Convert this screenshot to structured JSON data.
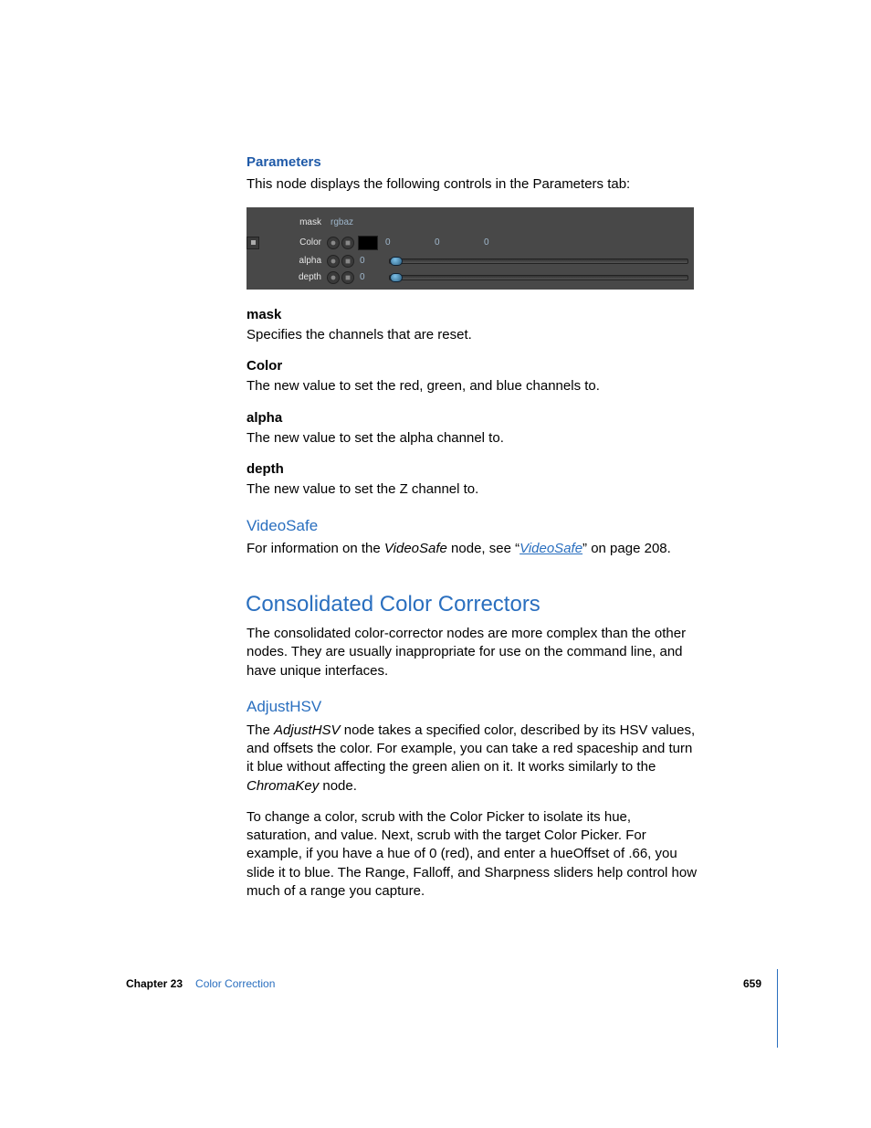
{
  "sections": {
    "parameters": {
      "heading": "Parameters",
      "intro": "This node displays the following controls in the Parameters tab:"
    },
    "panel": {
      "mask_label": "mask",
      "mask_value": "rgbaz",
      "color_label": "Color",
      "color_v1": "0",
      "color_v2": "0",
      "color_v3": "0",
      "alpha_label": "alpha",
      "alpha_value": "0",
      "depth_label": "depth",
      "depth_value": "0"
    },
    "params": {
      "mask": {
        "name": "mask",
        "desc": "Specifies the channels that are reset."
      },
      "color": {
        "name": "Color",
        "desc": "The new value to set the red, green, and blue channels to."
      },
      "alpha": {
        "name": "alpha",
        "desc": "The new value to set the alpha channel to."
      },
      "depth": {
        "name": "depth",
        "desc": "The new value to set the Z channel to."
      }
    },
    "videosafe": {
      "heading": "VideoSafe",
      "pre": "For information on the ",
      "node": "VideoSafe",
      "mid": " node, see “",
      "link": "VideoSafe",
      "post": "” on page 208."
    },
    "consolidated": {
      "heading": "Consolidated Color Correctors",
      "body": "The consolidated color-corrector nodes are more complex than the other nodes. They are usually inappropriate for use on the command line, and have unique interfaces."
    },
    "adjusthsv": {
      "heading": "AdjustHSV",
      "p1a": "The ",
      "p1b": "AdjustHSV",
      "p1c": " node takes a specified color, described by its HSV values, and offsets the color. For example, you can take a red spaceship and turn it blue without affecting the green alien on it. It works similarly to the ",
      "p1d": "ChromaKey",
      "p1e": " node.",
      "p2": "To change a color, scrub with the Color Picker to isolate its hue, saturation, and value. Next, scrub with the target Color Picker. For example, if you have a hue of 0 (red), and enter a hueOffset of .66, you slide it to blue. The Range, Falloff, and Sharpness sliders help control how much of a range you capture."
    }
  },
  "footer": {
    "chapter": "Chapter 23",
    "title": "Color Correction",
    "page": "659"
  }
}
